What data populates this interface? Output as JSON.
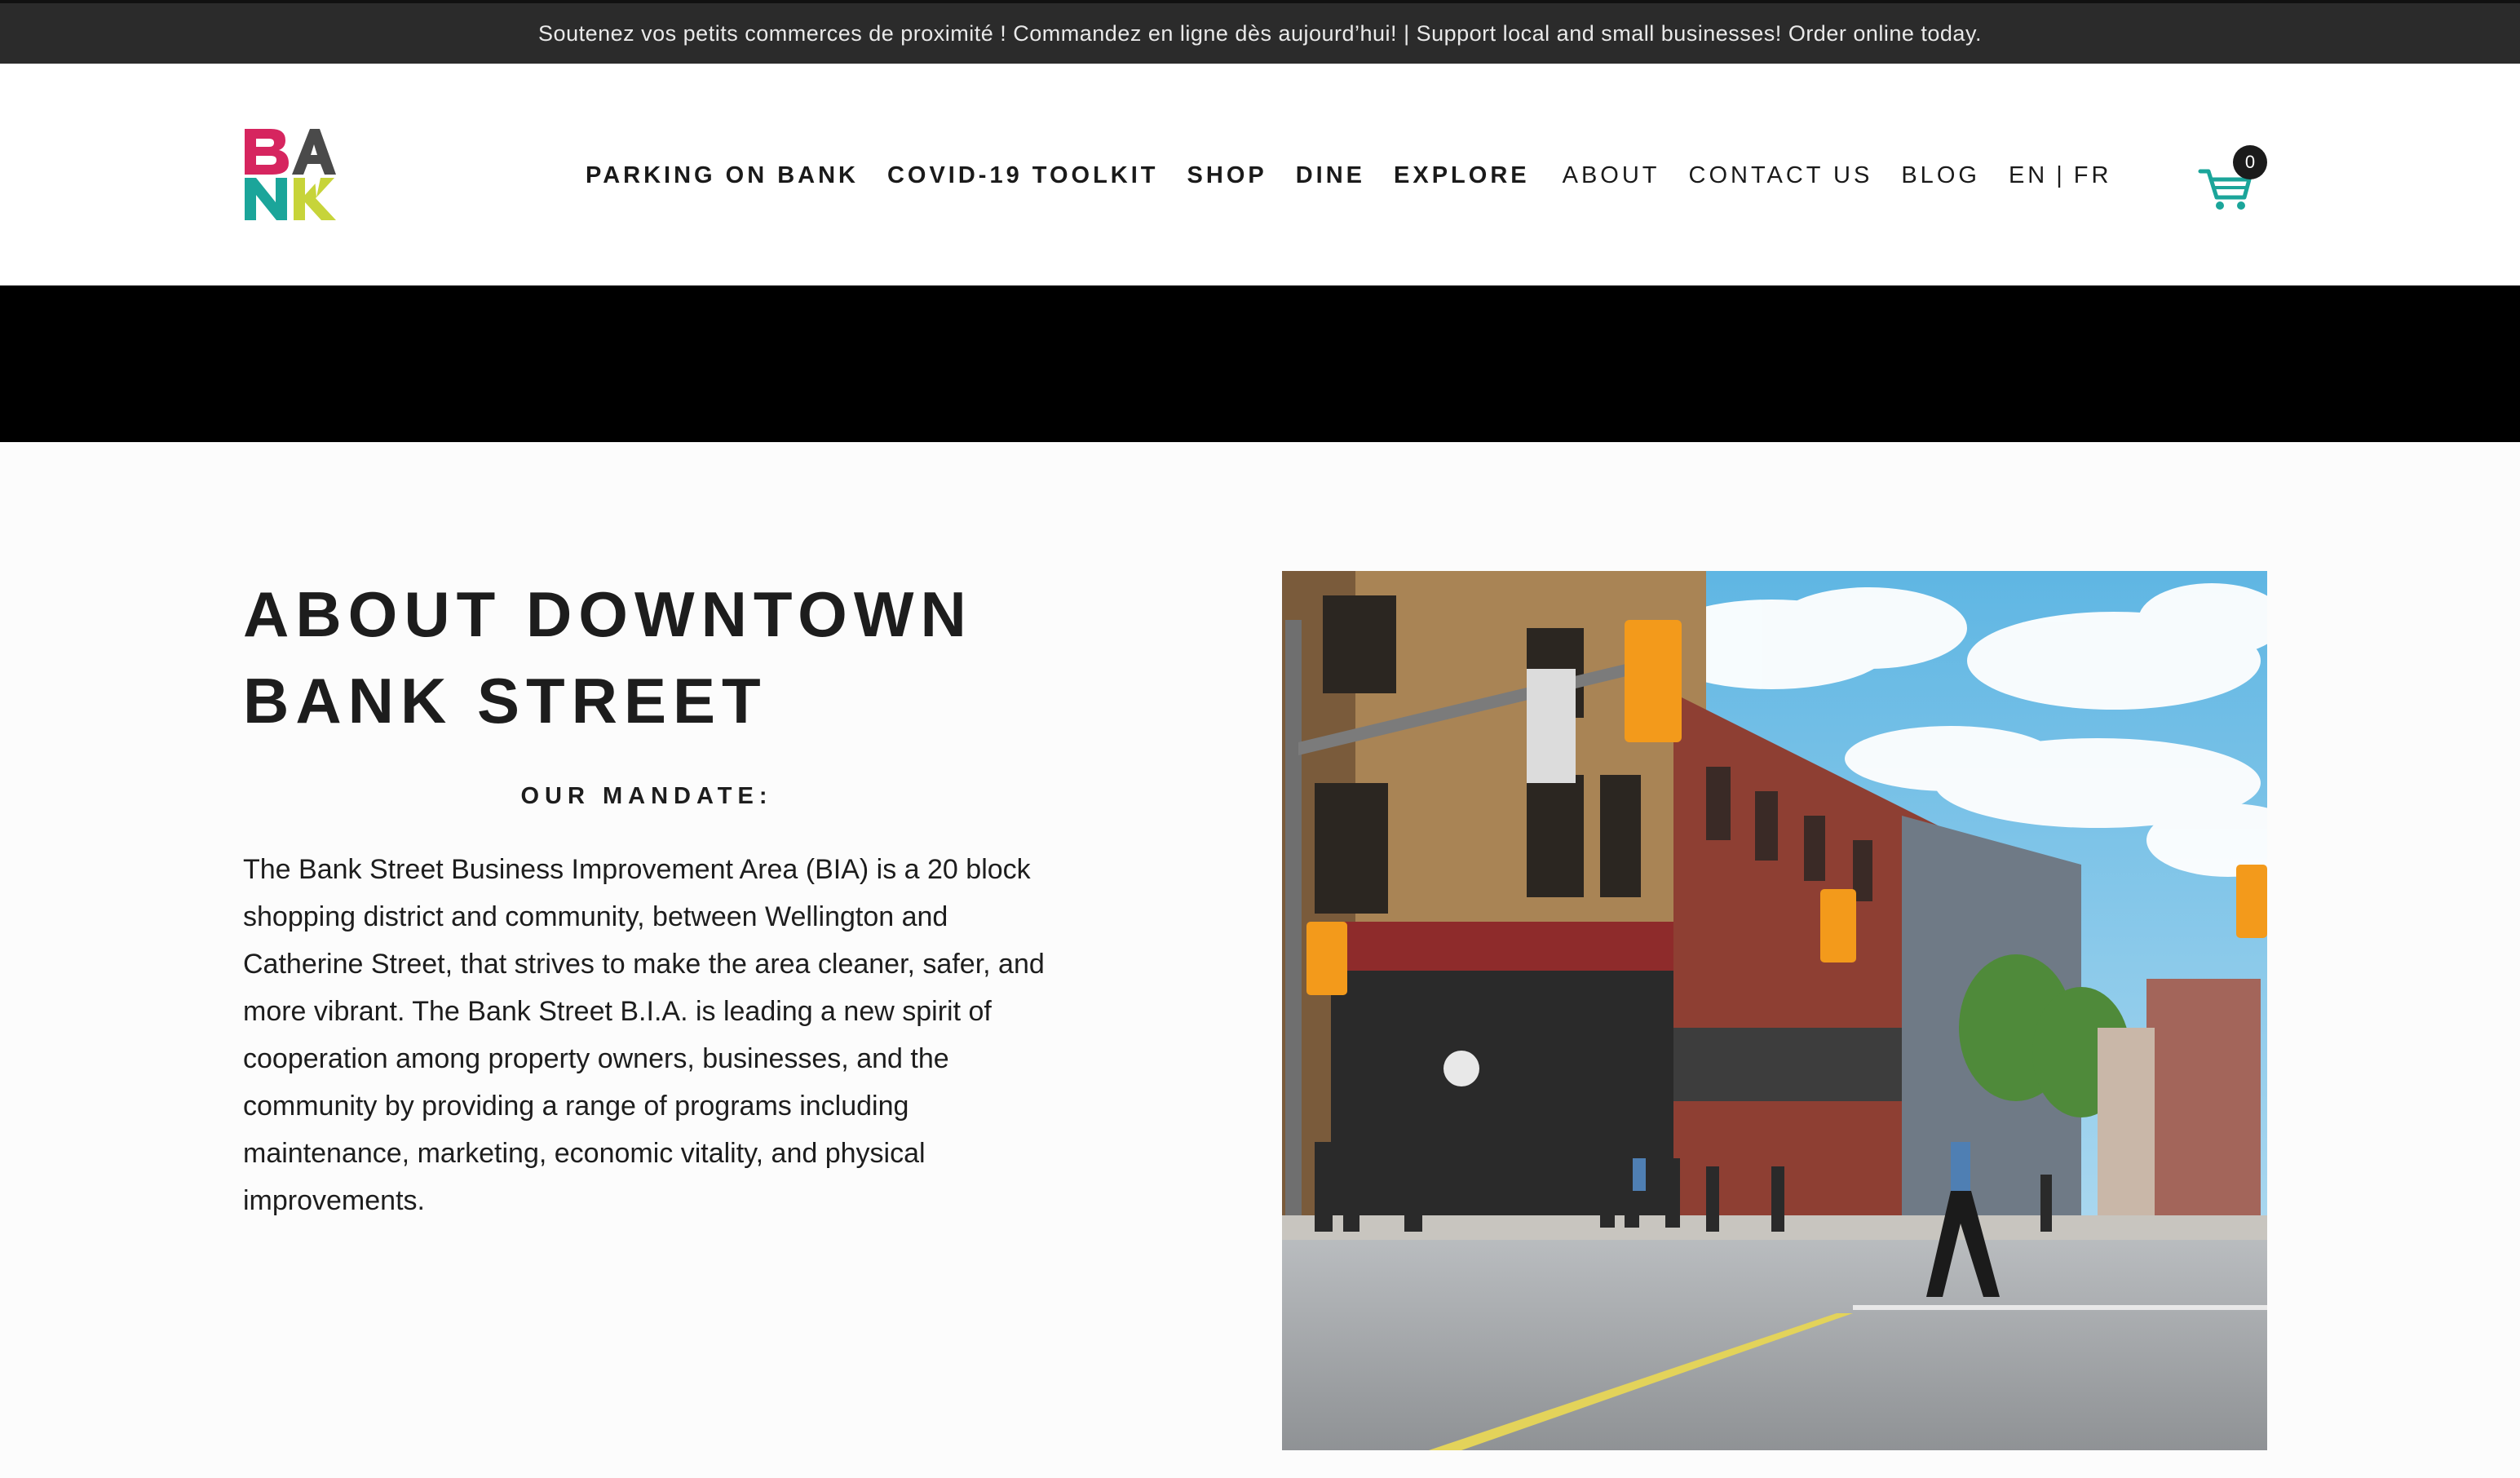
{
  "announcement": "Soutenez vos petits commerces de proximité ! Commandez en ligne dès aujourd’hui! | Support local and small businesses! Order online today.",
  "logo": {
    "letters": [
      "B",
      "A",
      "N",
      "K"
    ],
    "colors": [
      "#d6255f",
      "#4a4a4a",
      "#1ba59a",
      "#c7d43a"
    ]
  },
  "nav": {
    "items": [
      {
        "label": "PARKING ON BANK"
      },
      {
        "label": "COVID-19 TOOLKIT"
      },
      {
        "label": "SHOP"
      },
      {
        "label": "DINE"
      },
      {
        "label": "EXPLORE"
      },
      {
        "label": "ABOUT"
      },
      {
        "label": "CONTACT US"
      },
      {
        "label": "BLOG"
      }
    ],
    "lang_en": "EN",
    "lang_sep": "|",
    "lang_fr": "FR"
  },
  "cart": {
    "count": "0",
    "icon": "shopping-cart-icon",
    "color": "#1ba59a"
  },
  "main": {
    "title_line1": "ABOUT DOWNTOWN",
    "title_line2": "BANK STREET",
    "mandate_heading": "OUR MANDATE:",
    "body": "The Bank Street Business Improvement Area (BIA) is a 20 block shopping district and community, between Wellington and Catherine Street, that strives to make the area cleaner, safer, and more vibrant. The Bank Street B.I.A. is leading a new spirit of cooperation among property owners, businesses, and the community by providing a range of programs including maintenance, marketing, economic vitality, and physical improvements."
  }
}
